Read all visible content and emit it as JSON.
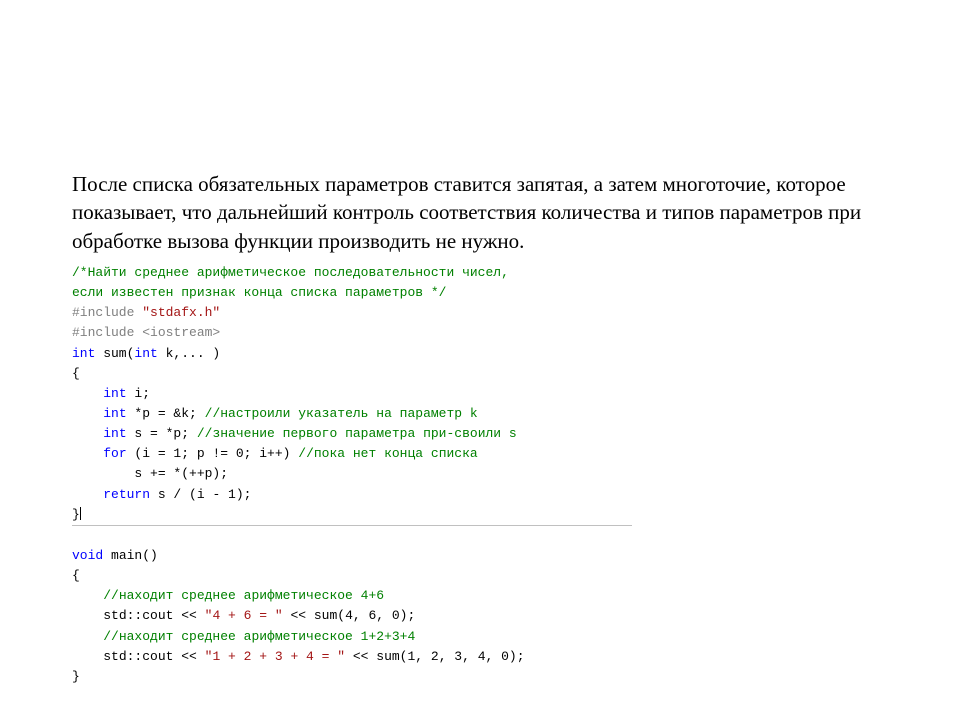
{
  "intro": "После списка обязательных параметров ставится запятая, а затем многоточие, которое показывает, что дальнейший контроль соответствия количества и типов параметров при обработке вызова функции производить не нужно.",
  "code": {
    "c01a": "/*Найти среднее арифметическое последовательности чисел,",
    "c01b": "если известен признак конца списка параметров */",
    "c02a": "#include ",
    "c02b": "\"stdafx.h\"",
    "c03a": "#include ",
    "c03b": "<iostream>",
    "c04a": "int",
    "c04b": " sum(",
    "c04c": "int",
    "c04d": " k,... )",
    "c05": "{",
    "i1": "    ",
    "i2": "        ",
    "c06a": "int",
    "c06b": " i;",
    "c07a": "int",
    "c07b": " *p = &k; ",
    "c07c": "//настроили указатель на параметр k",
    "c08a": "int",
    "c08b": " s = *p; ",
    "c08c": "//значение первого параметра при-своили s",
    "c09a": "for",
    "c09b": " (i = 1; p != 0; i++) ",
    "c09c": "//пока нет конца списка",
    "c10": "s += *(++p);",
    "c11a": "return",
    "c11b": " s / (i - 1);",
    "c12": "}",
    "blank": " ",
    "c13a": "void",
    "c13b": " main()",
    "c14": "{",
    "c15": "//находит среднее арифметическое 4+6",
    "c16a": "std::cout << ",
    "c16b": "\"4 + 6 = \"",
    "c16c": " << sum(4, 6, 0);",
    "c17": "//находит среднее арифметическое 1+2+3+4",
    "c18a": "std::cout << ",
    "c18b": "\"1 + 2 + 3 + 4 = \"",
    "c18c": " << sum(1, 2, 3, 4, 0);",
    "c19": "}"
  }
}
